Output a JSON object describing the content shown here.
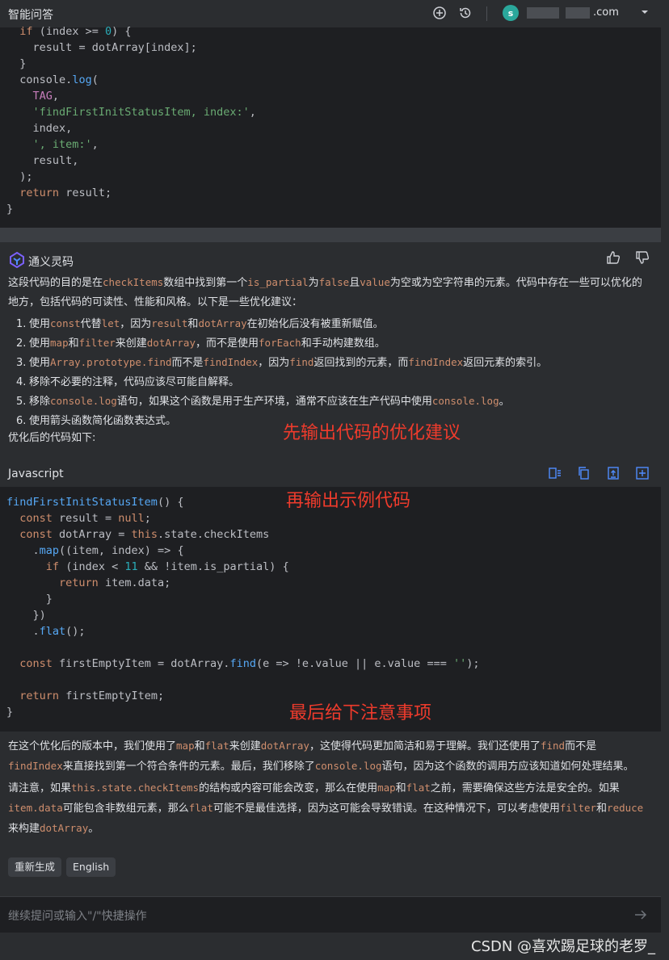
{
  "header": {
    "title": "智能问答",
    "avatar_letter": "s",
    "account_suffix": ".com"
  },
  "code_top": {
    "lines": [
      "  if (index >= 0) {",
      "    result = dotArray[index];",
      "  }",
      "  console.log(",
      "    TAG,",
      "    'findFirstInitStatusItem, index:',",
      "    index,",
      "    ', item:',",
      "    result,",
      "  );",
      "  return result;",
      "}"
    ]
  },
  "answer": {
    "bot_name": "通义灵码",
    "intro": [
      {
        "t": "这段代码的目的是在"
      },
      {
        "c": "checkItems"
      },
      {
        "t": "数组中找到第一个"
      },
      {
        "c": "is_partial"
      },
      {
        "t": "为"
      },
      {
        "c": "false"
      },
      {
        "t": "且"
      },
      {
        "c": "value"
      },
      {
        "t": "为空或为空字符串的元素。代码中存在一些可以优化的地方，包括代码的可读性、性能和风格。以下是一些优化建议："
      }
    ],
    "suggestions": [
      [
        {
          "t": "使用"
        },
        {
          "c": "const"
        },
        {
          "t": "代替"
        },
        {
          "c": "let"
        },
        {
          "t": "，因为"
        },
        {
          "c": "result"
        },
        {
          "t": "和"
        },
        {
          "c": "dotArray"
        },
        {
          "t": "在初始化后没有被重新赋值。"
        }
      ],
      [
        {
          "t": "使用"
        },
        {
          "c": "map"
        },
        {
          "t": "和"
        },
        {
          "c": "filter"
        },
        {
          "t": "来创建"
        },
        {
          "c": "dotArray"
        },
        {
          "t": "，而不是使用"
        },
        {
          "c": "forEach"
        },
        {
          "t": "和手动构建数组。"
        }
      ],
      [
        {
          "t": "使用"
        },
        {
          "c": "Array.prototype.find"
        },
        {
          "t": "而不是"
        },
        {
          "c": "findIndex"
        },
        {
          "t": "，因为"
        },
        {
          "c": "find"
        },
        {
          "t": "返回找到的元素，而"
        },
        {
          "c": "findIndex"
        },
        {
          "t": "返回元素的索引。"
        }
      ],
      [
        {
          "t": "移除不必要的注释，代码应该尽可能自解释。"
        }
      ],
      [
        {
          "t": "移除"
        },
        {
          "c": "console.log"
        },
        {
          "t": "语句，如果这个函数是用于生产环境，通常不应该在生产代码中使用"
        },
        {
          "c": "console.log"
        },
        {
          "t": "。"
        }
      ],
      [
        {
          "t": "使用箭头函数简化函数表达式。"
        }
      ]
    ],
    "after_label": "优化后的代码如下:",
    "code_lang": "Javascript",
    "code_lines": [
      "findFirstInitStatusItem() {",
      "  const result = null;",
      "  const dotArray = this.state.checkItems",
      "    .map((item, index) => {",
      "      if (index < 11 && !item.is_partial) {",
      "        return item.data;",
      "      }",
      "    })",
      "    .flat();",
      "",
      "  const firstEmptyItem = dotArray.find(e => !e.value || e.value === '');",
      "",
      "  return firstEmptyItem;",
      "}"
    ],
    "summary1": [
      {
        "t": "在这个优化后的版本中，我们使用了"
      },
      {
        "c": "map"
      },
      {
        "t": "和"
      },
      {
        "c": "flat"
      },
      {
        "t": "来创建"
      },
      {
        "c": "dotArray"
      },
      {
        "t": "，这使得代码更加简洁和易于理解。我们还使用了"
      },
      {
        "c": "find"
      },
      {
        "t": "而不是"
      },
      {
        "c": "findIndex"
      },
      {
        "t": "来直接找到第一个符合条件的元素。最后，我们移除了"
      },
      {
        "c": "console.log"
      },
      {
        "t": "语句，因为这个函数的调用方应该知道如何处理结果。"
      }
    ],
    "summary2": [
      {
        "t": "请注意，如果"
      },
      {
        "c": "this.state.checkItems"
      },
      {
        "t": "的结构或内容可能会改变，那么在使用"
      },
      {
        "c": "map"
      },
      {
        "t": "和"
      },
      {
        "c": "flat"
      },
      {
        "t": "之前，需要确保这些方法是安全的。如果"
      },
      {
        "c": "item.data"
      },
      {
        "t": "可能包含非数组元素，那么"
      },
      {
        "c": "flat"
      },
      {
        "t": "可能不是最佳选择，因为这可能会导致错误。在这种情况下，可以考虑使用"
      },
      {
        "c": "filter"
      },
      {
        "t": "和"
      },
      {
        "c": "reduce"
      },
      {
        "t": "来构建"
      },
      {
        "c": "dotArray"
      },
      {
        "t": "。"
      }
    ]
  },
  "annotations": {
    "a1": "先输出代码的优化建议",
    "a2": "再输出示例代码",
    "a3": "最后给下注意事项"
  },
  "actions": {
    "regenerate": "重新生成",
    "english": "English"
  },
  "input": {
    "placeholder": "继续提问或输入\"/\"快捷操作"
  },
  "watermark": "CSDN @喜欢踢足球的老罗_",
  "colors": {
    "background": "#2b2d30",
    "code_background": "#1e1f22",
    "inline_code": "#cf8e6d",
    "annotation": "#ef3b2c"
  }
}
